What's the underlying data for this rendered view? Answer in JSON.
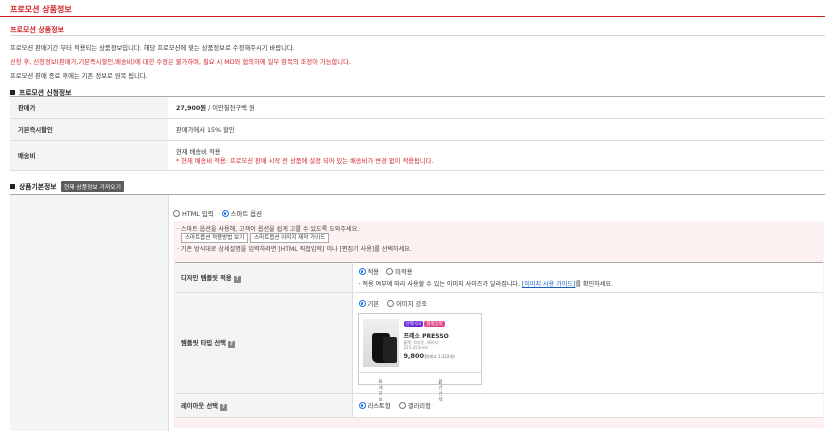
{
  "page": {
    "title": "프로모션 상품정보"
  },
  "section1": {
    "title": "프로모션 상품정보"
  },
  "notice": {
    "line1": "프로모션 판매기간 부터 적용되는 상품정보입니다. 해당 프로모션에 맞는 상품정보로 수정해주시기 바랍니다.",
    "line2": "신청 후, 신청정보(판매가,기본즉시할인,배송비)에 대한 수정은 불가하며, 필요 시 MD와 협의하에 일부 항목의 조정이 가능합니다.",
    "line3": "프로모션 판매 종료 후에는 기존 정보로 원복 됩니다."
  },
  "apply_section": {
    "title": "프로모션 신청정보"
  },
  "apply_rows": [
    {
      "label": "판매가",
      "value_bold": "27,900원",
      "value_rest": " / 이만칠천구백 원"
    },
    {
      "label": "기본즉시할인",
      "value": "판매가에서 15% 할인"
    },
    {
      "label": "배송비",
      "value": "현재 배송비 적용",
      "note": "* 현재 배송비 적용: 프로모션 판매 시작 전 상품에 설정 되어 있는 배송비가 변경 없이 적용됩니다."
    }
  ],
  "basic_section": {
    "title": "상품기본정보",
    "button": "현재 상품정보 가져오기"
  },
  "editor_modes": {
    "html": "HTML 입력",
    "smart": "스마트 옵션"
  },
  "smart_info": {
    "line1": "· 스마트 옵션을 사용해, 고객이 옵션을 쉽게 고를 수 있도록 도와주세요.",
    "btn1": "스마트옵션 적용방법 보기",
    "btn2": "스마트옵션 이미지 제작 가이드",
    "line2": "· 기존 방식대로 상세설명을 입력하려면 [HTML 직접입력] 이나 [편집기 사용]를 선택하세요."
  },
  "design_template": {
    "label": "디자인 템플릿 적용",
    "help": "?",
    "opt_on": "적용",
    "opt_off": "미적용",
    "desc": "· 적용 여부에 따라 사용할 수 있는 이미지 사이즈가 달라집니다.",
    "link": "[이미지 사용 가이드]",
    "desc_tail": "를 확인하세요."
  },
  "template_type": {
    "label": "템플릿 타입 선택",
    "help": "?",
    "opt_basic": "기본",
    "opt_image": "이미지 강조",
    "card": {
      "badge1": "선택 03",
      "badge2": "품절임박",
      "name": "프레소 PRESSO",
      "desc1": "블랙, 브라운, 베이지",
      "desc2": "225-255mm",
      "price": "9,800",
      "price_note": "원(재고 1,322개)",
      "foot_left": "자세히보기",
      "foot_right": "옵션선택"
    }
  },
  "layout_select": {
    "label": "레이아웃 선택",
    "help": "?",
    "opt_list": "리스트형",
    "opt_gallery": "갤러리형"
  }
}
